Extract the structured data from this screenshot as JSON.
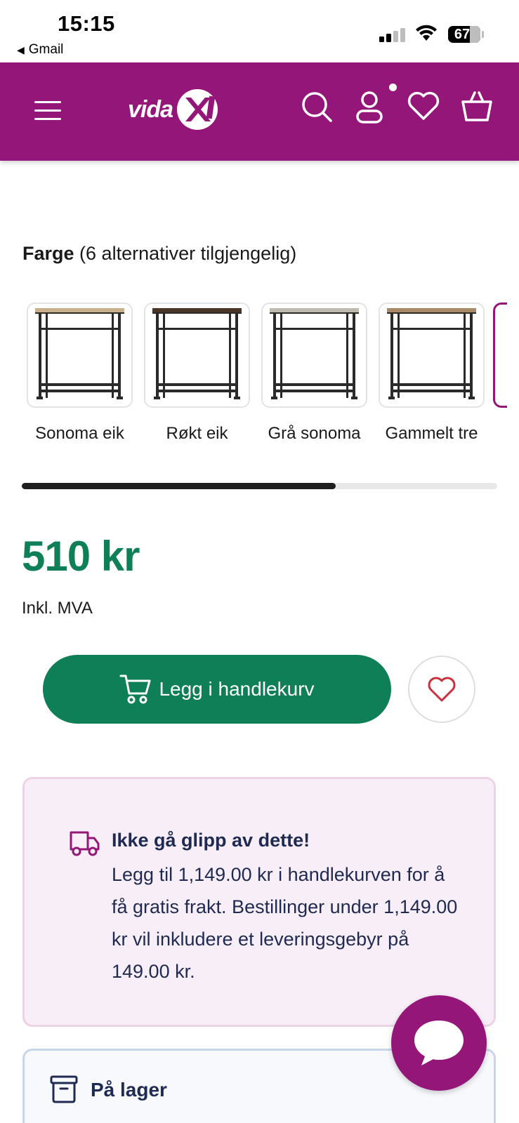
{
  "status_bar": {
    "time": "15:15",
    "back_app": "Gmail",
    "battery": "67"
  },
  "header": {
    "logo": "vidaXL",
    "logo_text": "vida",
    "icons": [
      "menu-icon",
      "search-icon",
      "account-icon",
      "heart-icon",
      "basket-icon"
    ],
    "brand_color": "#941678"
  },
  "color_selector": {
    "title": "Farge",
    "subtitle": "(6 alternativer tilgjengelig)",
    "options": [
      {
        "label": "Sonoma eik",
        "top": "#c9b08a"
      },
      {
        "label": "Røkt eik",
        "top": "#4a3526"
      },
      {
        "label": "Grå sonoma",
        "top": "#bfbab0"
      },
      {
        "label": "Gammelt tre",
        "top": "#a88a66"
      }
    ],
    "scroll_progress": 0.66
  },
  "product": {
    "price": "510 kr",
    "vat_note": "Inkl. MVA",
    "price_color": "#0e7f57"
  },
  "actions": {
    "add_to_cart": "Legg i handlekurv"
  },
  "shipping_notice": {
    "title": "Ikke gå glipp av dette!",
    "body": "Legg til 1,149.00 kr i handlekurven for å få gratis frakt. Bestillinger under 1,149.00 kr vil inkludere et leveringsgebyr på 149.00 kr."
  },
  "stock": {
    "label": "På lager"
  }
}
